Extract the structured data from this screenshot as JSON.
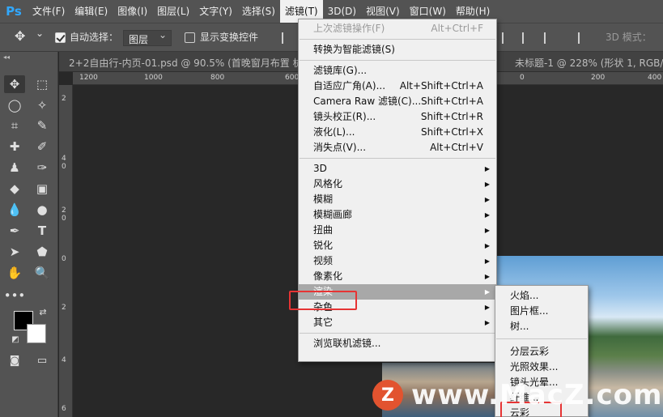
{
  "app": {
    "logo": "Ps"
  },
  "menubar": [
    {
      "label": "文件(F)"
    },
    {
      "label": "编辑(E)"
    },
    {
      "label": "图像(I)"
    },
    {
      "label": "图层(L)"
    },
    {
      "label": "文字(Y)"
    },
    {
      "label": "选择(S)"
    },
    {
      "label": "滤镜(T)",
      "active": true
    },
    {
      "label": "3D(D)"
    },
    {
      "label": "视图(V)"
    },
    {
      "label": "窗口(W)"
    },
    {
      "label": "帮助(H)"
    }
  ],
  "options": {
    "auto_select_label": "自动选择：",
    "auto_select_checked": true,
    "layer_select_value": "图层",
    "show_transform_label": "显示变换控件",
    "show_transform_checked": false,
    "mode_3d_label": "3D 模式："
  },
  "documents": {
    "tab1": "2+2自由行-内页-01.psd @ 90.5% (首晚窗月布置 杭",
    "tab2": "未标题-1 @ 228% (形状 1, RGB/8"
  },
  "ruler": {
    "h_labels": [
      "1200",
      "1000",
      "800",
      "600",
      "400",
      "200",
      "0",
      "200",
      "400"
    ],
    "v_labels": [
      "2",
      "4 0",
      "2 0",
      "0",
      "2",
      "4",
      "6"
    ]
  },
  "filter_menu": {
    "items": [
      {
        "label": "上次滤镜操作(F)",
        "shortcut": "Alt+Ctrl+F",
        "disabled": true
      },
      {
        "sep": true
      },
      {
        "label": "转换为智能滤镜(S)"
      },
      {
        "sep": true
      },
      {
        "label": "滤镜库(G)..."
      },
      {
        "label": "自适应广角(A)...",
        "shortcut": "Alt+Shift+Ctrl+A"
      },
      {
        "label": "Camera Raw 滤镜(C)...",
        "shortcut": "Shift+Ctrl+A"
      },
      {
        "label": "镜头校正(R)...",
        "shortcut": "Shift+Ctrl+R"
      },
      {
        "label": "液化(L)...",
        "shortcut": "Shift+Ctrl+X"
      },
      {
        "label": "消失点(V)...",
        "shortcut": "Alt+Ctrl+V"
      },
      {
        "sep": true
      },
      {
        "label": "3D",
        "submenu": true
      },
      {
        "label": "风格化",
        "submenu": true
      },
      {
        "label": "模糊",
        "submenu": true
      },
      {
        "label": "模糊画廊",
        "submenu": true
      },
      {
        "label": "扭曲",
        "submenu": true
      },
      {
        "label": "锐化",
        "submenu": true
      },
      {
        "label": "视频",
        "submenu": true
      },
      {
        "label": "像素化",
        "submenu": true
      },
      {
        "label": "渲染",
        "submenu": true,
        "highlighted": true
      },
      {
        "label": "杂色",
        "submenu": true
      },
      {
        "label": "其它",
        "submenu": true
      },
      {
        "sep": true
      },
      {
        "label": "浏览联机滤镜..."
      }
    ]
  },
  "render_menu": {
    "items": [
      {
        "label": "火焰..."
      },
      {
        "label": "图片框..."
      },
      {
        "label": "树..."
      },
      {
        "sep": true
      },
      {
        "label": "分层云彩"
      },
      {
        "label": "光照效果..."
      },
      {
        "label": "镜头光晕..."
      },
      {
        "label": "纤维..."
      },
      {
        "label": "云彩"
      }
    ]
  },
  "watermark": {
    "badge": "Z",
    "text": "www.MacZ.com"
  },
  "colors": {
    "menubar": "#535353",
    "menu_bg": "#f0f0f0",
    "highlight": "#a8a8a8",
    "callout": "#e63434",
    "ps_blue": "#31a8ff"
  }
}
